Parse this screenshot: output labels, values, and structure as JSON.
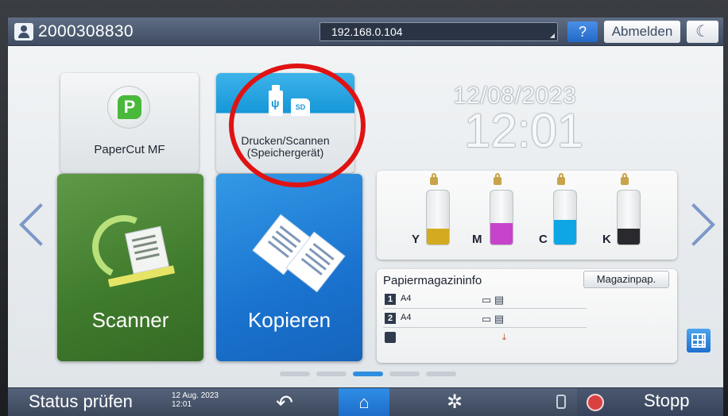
{
  "topbar": {
    "user_id": "2000308830",
    "ip_address": "192.168.0.104",
    "help_label": "?",
    "logout_label": "Abmelden",
    "moon_label": "☾"
  },
  "apps": {
    "papercut_label": "PaperCut MF",
    "usb_label_line1": "Drucken/Scannen",
    "usb_label_line2": "(Speichergerät)",
    "usb_sd_text": "SD",
    "scanner_label": "Scanner",
    "copy_label": "Kopieren"
  },
  "clock": {
    "date": "12/08/2023",
    "time": "12:01"
  },
  "toner": [
    {
      "letter": "Y",
      "level": 0.3,
      "color": "#d4ab1f"
    },
    {
      "letter": "M",
      "level": 0.4,
      "color": "#c743cc"
    },
    {
      "letter": "C",
      "level": 0.45,
      "color": "#0ea6e4"
    },
    {
      "letter": "K",
      "level": 0.3,
      "color": "#2a2a2e"
    }
  ],
  "paper": {
    "title": "Papiermagazininfo",
    "button_label": "Magazinpap.",
    "tray1_num": "1",
    "tray1_size": "A4",
    "tray2_num": "2",
    "tray2_size": "A4",
    "tray_icon": "▭ ▤"
  },
  "pager": {
    "active_index": 2,
    "count": 5
  },
  "bottombar": {
    "status_label": "Status prüfen",
    "date_short": "12 Aug. 2023",
    "time_short": "12:01",
    "back_glyph": "↶",
    "home_glyph": "⌂",
    "settings_glyph": "✲",
    "stop_label": "Stopp"
  },
  "colors": {
    "accent_blue": "#1597d8",
    "scanner_green": "#3f7a2c",
    "annotation_red": "#e01313"
  }
}
